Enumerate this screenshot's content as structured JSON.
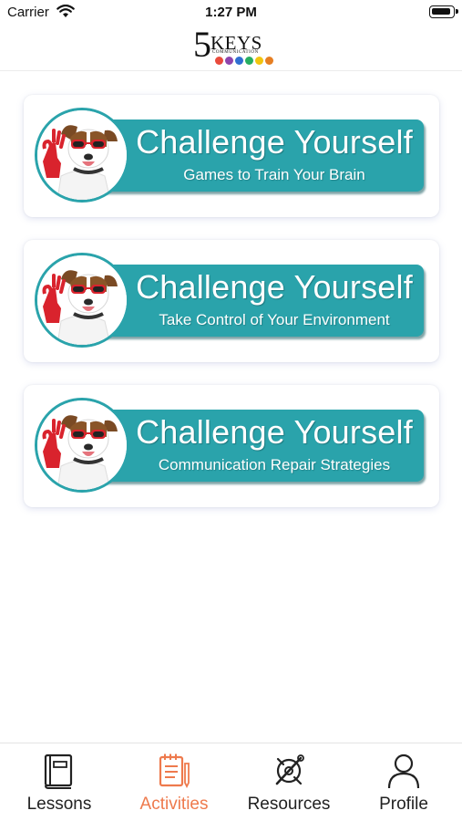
{
  "status_bar": {
    "carrier": "Carrier",
    "time": "1:27 PM"
  },
  "header": {
    "logo": {
      "numeral": "5",
      "word": "KEYS",
      "tagline": "COMMUNICATION",
      "dot_colors": [
        "#e94b3c",
        "#8e44ad",
        "#2f6fd1",
        "#27ae60",
        "#f1c40f",
        "#e67e22"
      ]
    }
  },
  "activities": [
    {
      "title": "Challenge Yourself",
      "subtitle": "Games to Train Your Brain"
    },
    {
      "title": "Challenge Yourself",
      "subtitle": "Take Control of Your Environment"
    },
    {
      "title": "Challenge Yourself",
      "subtitle": "Communication Repair Strategies"
    }
  ],
  "colors": {
    "banner": "#2aa3ab",
    "accent": "#ee7a4d"
  },
  "tab_bar": {
    "tabs": [
      {
        "label": "Lessons",
        "icon": "book-icon"
      },
      {
        "label": "Activities",
        "icon": "notepad-icon"
      },
      {
        "label": "Resources",
        "icon": "tools-icon"
      },
      {
        "label": "Profile",
        "icon": "person-icon"
      }
    ],
    "active": "Activities"
  }
}
